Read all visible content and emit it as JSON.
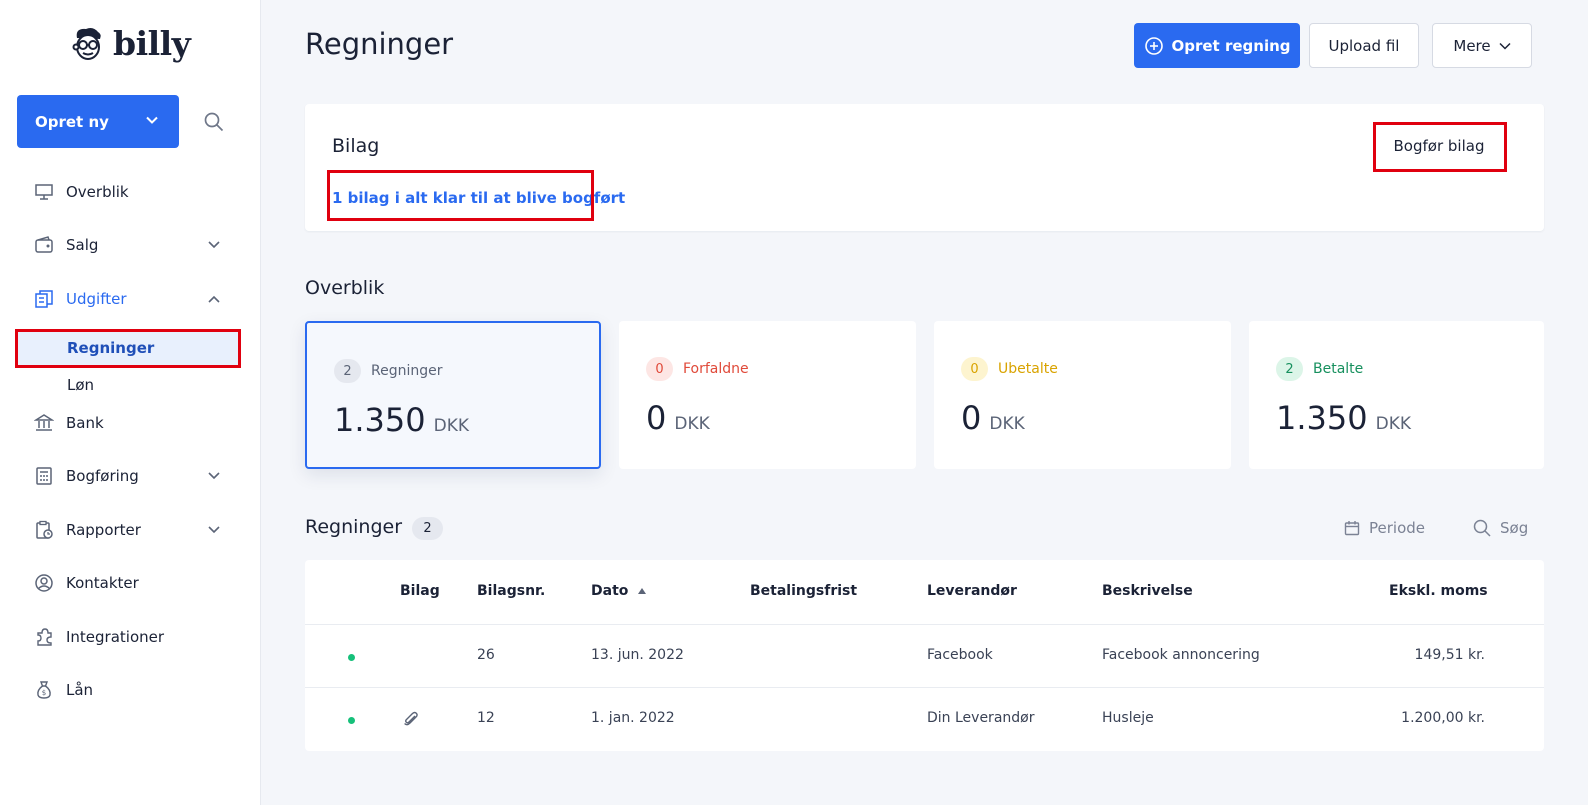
{
  "brand": {
    "name": "billy"
  },
  "sidebar": {
    "create_label": "Opret ny",
    "items": [
      {
        "label": "Overblik"
      },
      {
        "label": "Salg"
      },
      {
        "label": "Udgifter"
      },
      {
        "label": "Regninger"
      },
      {
        "label": "Løn"
      },
      {
        "label": "Bank"
      },
      {
        "label": "Bogføring"
      },
      {
        "label": "Rapporter"
      },
      {
        "label": "Kontakter"
      },
      {
        "label": "Integrationer"
      },
      {
        "label": "Lån"
      }
    ]
  },
  "header": {
    "title": "Regninger",
    "create_bill_label": "Opret regning",
    "upload_label": "Upload fil",
    "more_label": "Mere"
  },
  "bilag": {
    "title": "Bilag",
    "link": "1 bilag i alt klar til at blive bogført",
    "action": "Bogfør bilag"
  },
  "overview": {
    "title": "Overblik",
    "cards": [
      {
        "count": "2",
        "label": "Regninger",
        "amount": "1.350",
        "currency": "DKK",
        "color": "#5b6477",
        "pill_bg": "#e5e8ef"
      },
      {
        "count": "0",
        "label": "Forfaldne",
        "amount": "0",
        "currency": "DKK",
        "color": "#e04a3a",
        "pill_bg": "#fde6e4"
      },
      {
        "count": "0",
        "label": "Ubetalte",
        "amount": "0",
        "currency": "DKK",
        "color": "#d9a300",
        "pill_bg": "#fdf4cf"
      },
      {
        "count": "2",
        "label": "Betalte",
        "amount": "1.350",
        "currency": "DKK",
        "color": "#17905e",
        "pill_bg": "#dcf5e8"
      }
    ]
  },
  "bills": {
    "title": "Regninger",
    "count": "2",
    "period_label": "Periode",
    "search_label": "Søg",
    "columns": {
      "bilag": "Bilag",
      "bilagsnr": "Bilagsnr.",
      "dato": "Dato",
      "betalingsfrist": "Betalingsfrist",
      "leverandor": "Leverandør",
      "beskrivelse": "Beskrivelse",
      "ekskl_moms": "Ekskl. moms"
    },
    "rows": [
      {
        "bilagsnr": "26",
        "dato": "13. jun. 2022",
        "betalingsfrist": "",
        "leverandor": "Facebook",
        "beskrivelse": "Facebook annoncering",
        "ekskl_moms": "149,51 kr.",
        "attachment": false
      },
      {
        "bilagsnr": "12",
        "dato": "1. jan. 2022",
        "betalingsfrist": "",
        "leverandor": "Din Leverandør",
        "beskrivelse": "Husleje",
        "ekskl_moms": "1.200,00 kr.",
        "attachment": true
      }
    ]
  },
  "colors": {
    "accent": "#2a6af0",
    "highlight": "#e0000f",
    "status_dot": "#16c07a"
  }
}
